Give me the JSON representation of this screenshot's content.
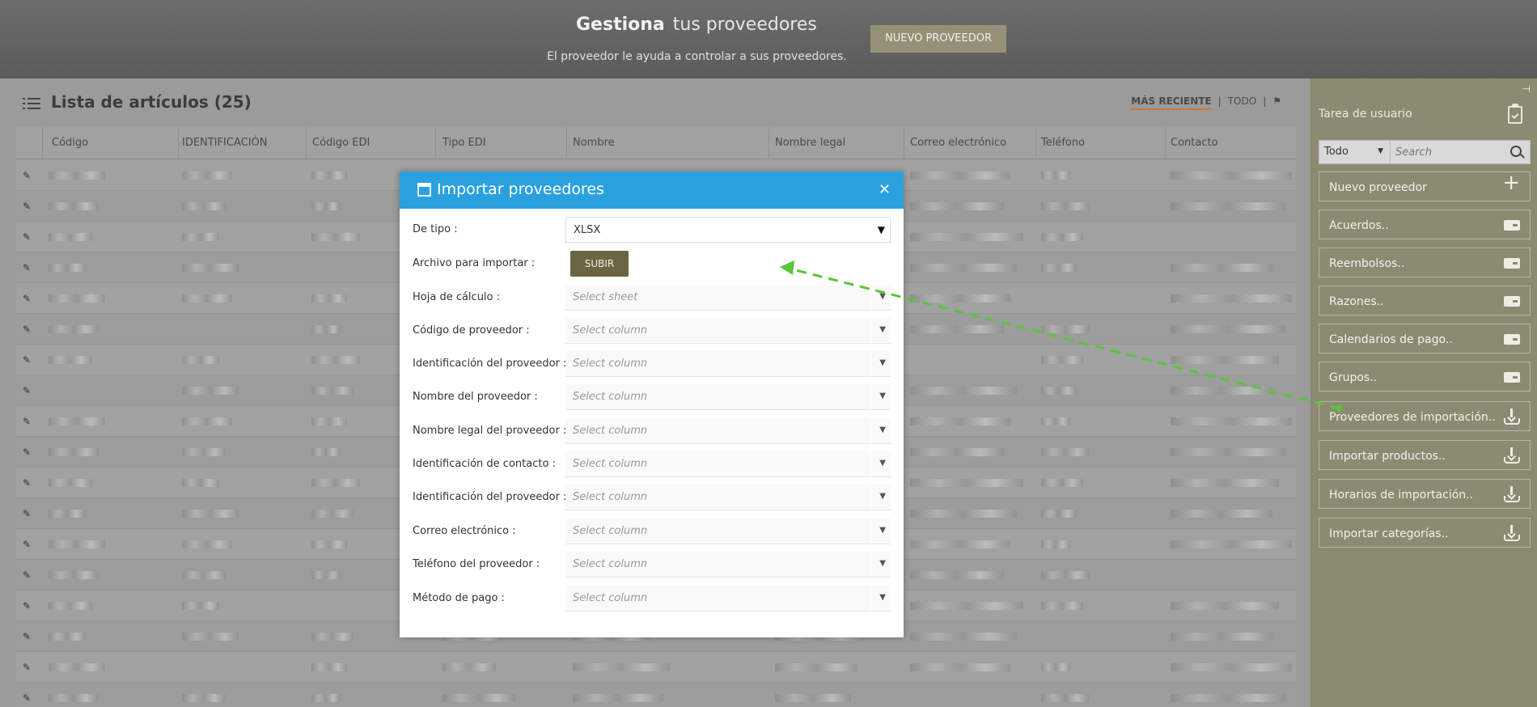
{
  "header": {
    "title_bold": "Gestiona",
    "title_rest": "tus proveedores",
    "subtitle": "El proveedor le ayuda a controlar a sus proveedores.",
    "new_button": "NUEVO PROVEEDOR"
  },
  "list": {
    "title": "Lista de artículos (25)",
    "filter_recent": "MÁS RECIENTE",
    "filter_all": "TODO",
    "columns": [
      "Código",
      "IDENTIFICACIÓN",
      "Código EDI",
      "Tipo EDI",
      "Nombre",
      "Nombre legal",
      "Correo electrónico",
      "Teléfono",
      "Contacto"
    ]
  },
  "sidebar": {
    "section_title": "Tarea de usuario",
    "filter_value": "Todo",
    "search_placeholder": "Search",
    "buttons": [
      {
        "label": "Nuevo proveedor",
        "icon": "plus-icon"
      },
      {
        "label": "Acuerdos..",
        "icon": "card-icon"
      },
      {
        "label": "Reembolsos..",
        "icon": "card-icon"
      },
      {
        "label": "Razones..",
        "icon": "card-icon"
      },
      {
        "label": "Calendarios de pago..",
        "icon": "card-icon"
      },
      {
        "label": "Grupos..",
        "icon": "card-icon"
      },
      {
        "label": "Proveedores de importación..",
        "icon": "download-icon"
      },
      {
        "label": "Importar productos..",
        "icon": "download-icon"
      },
      {
        "label": "Horarios de importación..",
        "icon": "download-icon"
      },
      {
        "label": "Importar categorías..",
        "icon": "download-icon"
      }
    ]
  },
  "modal": {
    "title": "Importar proveedores",
    "upload_button": "SUBIR",
    "fields": [
      {
        "label": "De tipo",
        "value": "XLSX"
      },
      {
        "label": "Archivo para importar"
      },
      {
        "label": "Hoja de cálculo",
        "placeholder": "Select sheet"
      },
      {
        "label": "Código de proveedor",
        "placeholder": "Select column"
      },
      {
        "label": "Identificación del proveedor",
        "placeholder": "Select column"
      },
      {
        "label": "Nombre del proveedor",
        "placeholder": "Select column"
      },
      {
        "label": "Nombre legal del proveedor",
        "placeholder": "Select column"
      },
      {
        "label": "Identificación de contacto",
        "placeholder": "Select column"
      },
      {
        "label": "Identificación del proveedor",
        "placeholder": "Select column"
      },
      {
        "label": "Correo electrónico",
        "placeholder": "Select column"
      },
      {
        "label": "Teléfono del proveedor",
        "placeholder": "Select column"
      },
      {
        "label": "Método de pago",
        "placeholder": "Select column"
      }
    ]
  },
  "colors": {
    "modal_header": "#2aa1de",
    "sidebar": "#8c8a73",
    "annotation_arrow": "#5cc43a",
    "upload_button": "#6b6543"
  }
}
